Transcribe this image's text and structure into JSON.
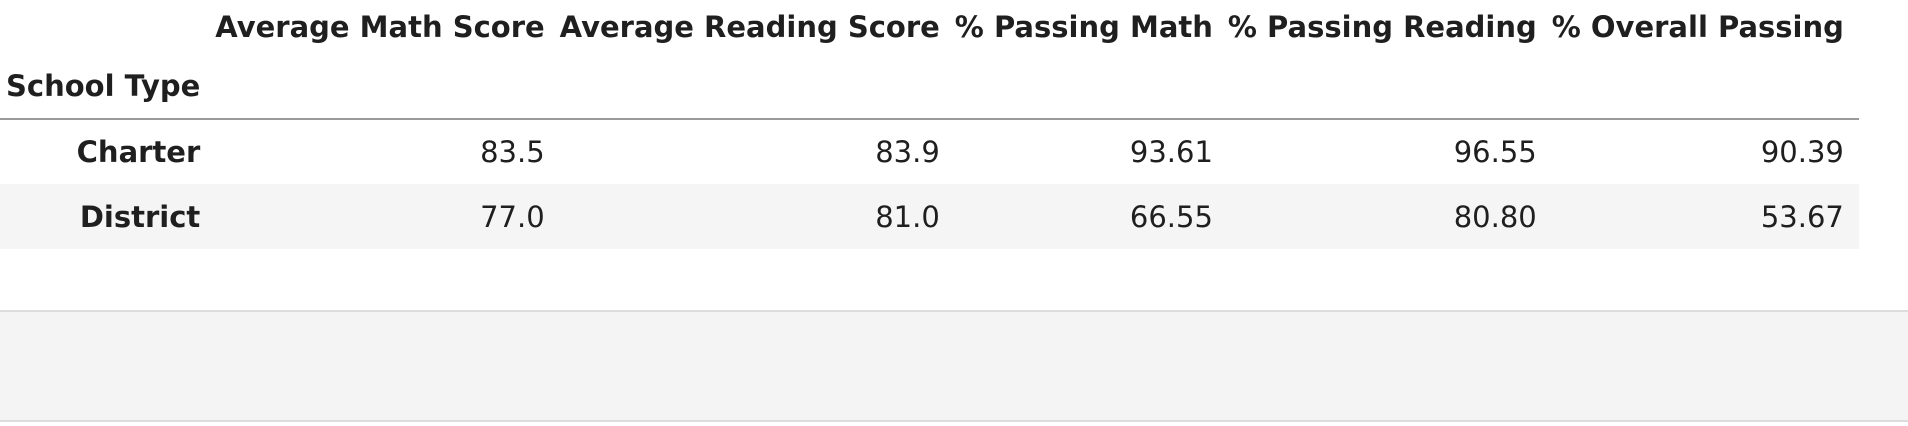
{
  "table": {
    "index_name": "School Type",
    "columns": [
      "Average Math Score",
      "Average Reading Score",
      "% Passing Math",
      "% Passing Reading",
      "% Overall Passing"
    ],
    "rows": [
      {
        "label": "Charter",
        "values": [
          "83.5",
          "83.9",
          "93.61",
          "96.55",
          "90.39"
        ]
      },
      {
        "label": "District",
        "values": [
          "77.0",
          "81.0",
          "66.55",
          "80.80",
          "53.67"
        ]
      }
    ]
  }
}
